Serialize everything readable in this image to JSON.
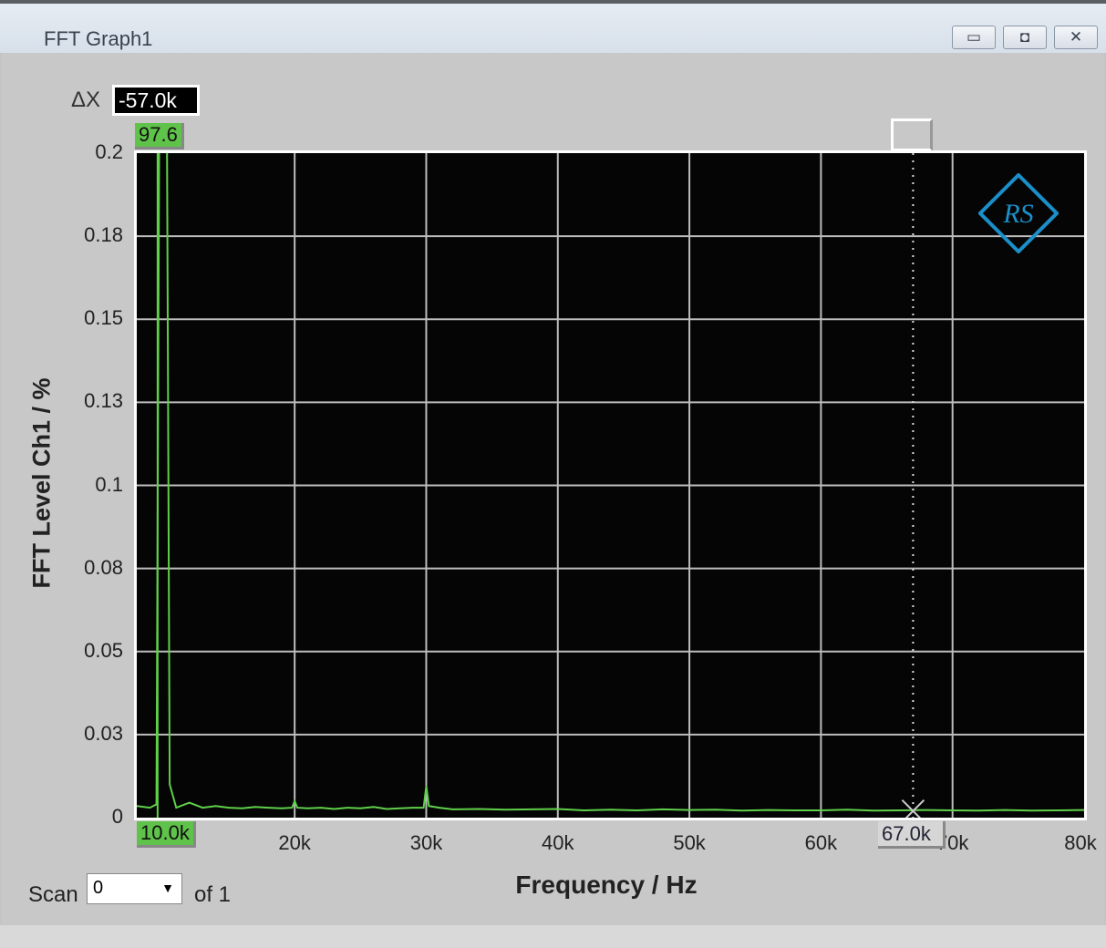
{
  "window": {
    "title": "FFT Graph1",
    "buttons": {
      "minimize": "▭",
      "restore": "◘",
      "close": "✕"
    }
  },
  "cursor": {
    "delta_label": "ΔX",
    "delta_value": "-57.0k",
    "cursor1_y": "97.6",
    "cursor1_x": "10.0k",
    "cursor2_x": "67.0k"
  },
  "scan": {
    "label": "Scan",
    "value": "0",
    "of": "of 1"
  },
  "colors": {
    "trace": "#5fd04a",
    "grid": "#bdbdbd",
    "logo": "#1a8fc9"
  },
  "chart_data": {
    "type": "line",
    "title": "FFT Graph1",
    "xlabel": "Frequency / Hz",
    "ylabel": "FFT Level Ch1 / %",
    "xlim": [
      8000,
      80000
    ],
    "ylim": [
      0,
      0.2
    ],
    "grid": true,
    "xticks": [
      {
        "v": 20000,
        "label": "20k"
      },
      {
        "v": 30000,
        "label": "30k"
      },
      {
        "v": 40000,
        "label": "40k"
      },
      {
        "v": 50000,
        "label": "50k"
      },
      {
        "v": 60000,
        "label": "60k"
      },
      {
        "v": 70000,
        "label": "70k"
      },
      {
        "v": 80000,
        "label": "80k"
      }
    ],
    "yticks": [
      {
        "v": 0,
        "label": "0"
      },
      {
        "v": 0.025,
        "label": "0.03"
      },
      {
        "v": 0.05,
        "label": "0.05"
      },
      {
        "v": 0.075,
        "label": "0.08"
      },
      {
        "v": 0.1,
        "label": "0.1"
      },
      {
        "v": 0.125,
        "label": "0.13"
      },
      {
        "v": 0.15,
        "label": "0.15"
      },
      {
        "v": 0.175,
        "label": "0.18"
      },
      {
        "v": 0.2,
        "label": "0.2"
      }
    ],
    "series": [
      {
        "name": "Ch1",
        "x": [
          8000,
          9000,
          9500,
          9700,
          10000,
          10300,
          10500,
          11000,
          12000,
          13000,
          14000,
          15000,
          16000,
          17000,
          18000,
          19000,
          19800,
          20000,
          20200,
          21000,
          22000,
          23000,
          24000,
          25000,
          26000,
          27000,
          28000,
          29000,
          29800,
          30000,
          30200,
          31000,
          32000,
          34000,
          36000,
          38000,
          40000,
          42000,
          44000,
          46000,
          48000,
          50000,
          52000,
          54000,
          56000,
          58000,
          60000,
          62000,
          64000,
          66000,
          68000,
          70000,
          72000,
          74000,
          76000,
          78000,
          80000
        ],
        "y": [
          0.0035,
          0.003,
          0.004,
          0.2,
          97.6,
          0.2,
          0.01,
          0.003,
          0.0045,
          0.003,
          0.0035,
          0.003,
          0.0028,
          0.0032,
          0.003,
          0.0028,
          0.003,
          0.005,
          0.003,
          0.0028,
          0.003,
          0.0026,
          0.003,
          0.0028,
          0.0032,
          0.0026,
          0.0028,
          0.003,
          0.003,
          0.0095,
          0.0035,
          0.003,
          0.0025,
          0.0026,
          0.0024,
          0.0025,
          0.0026,
          0.0022,
          0.0024,
          0.0022,
          0.0025,
          0.0023,
          0.0024,
          0.0021,
          0.0023,
          0.0022,
          0.0022,
          0.0024,
          0.0021,
          0.0022,
          0.0023,
          0.0022,
          0.0021,
          0.0023,
          0.0021,
          0.0022,
          0.0023
        ]
      }
    ],
    "markers": [
      {
        "x": 10000,
        "y": 97.6,
        "label": "10.0k"
      },
      {
        "x": 67000,
        "label": "67.0k"
      }
    ]
  }
}
